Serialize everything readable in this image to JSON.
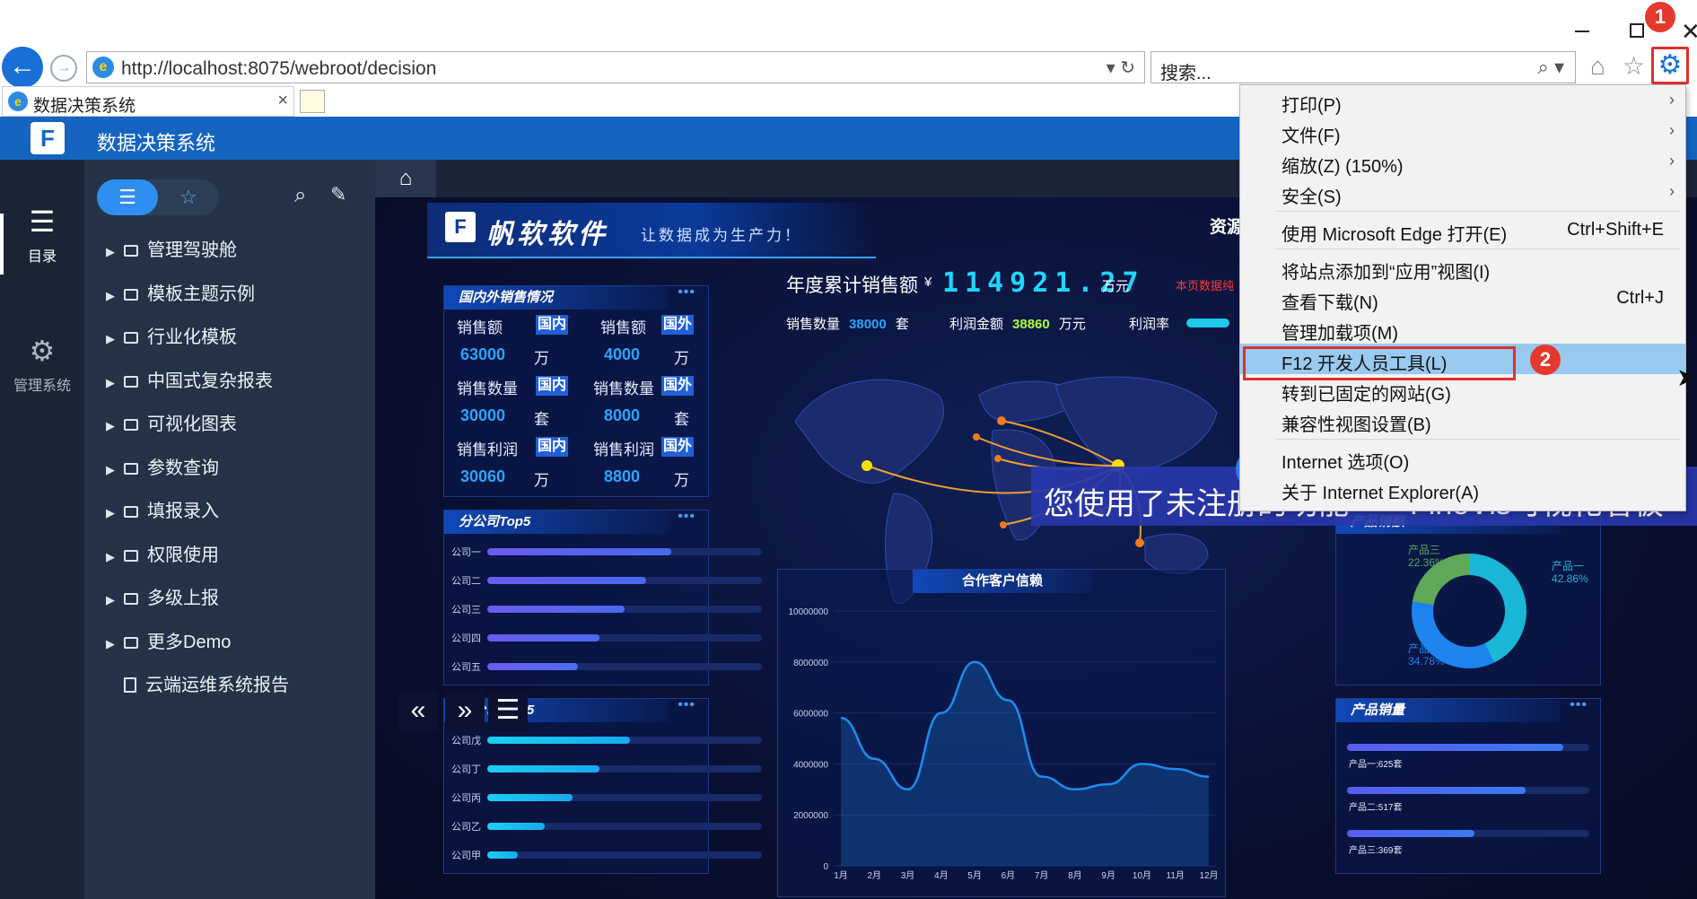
{
  "browser": {
    "address_url": "http://localhost:8075/webroot/decision",
    "search_placeholder": "搜索...",
    "tab_title": "数据决策系统",
    "markers": [
      "1",
      "2"
    ],
    "icons": [
      "back-icon",
      "forward-icon",
      "refresh-icon",
      "search-icon",
      "home-icon",
      "favorites-star-icon",
      "gear-icon"
    ]
  },
  "app": {
    "title": "数据决策系统",
    "rail": [
      {
        "label": "目录",
        "icon": "list-icon"
      },
      {
        "label": "管理系统",
        "icon": "gear-icon"
      }
    ],
    "directory": [
      {
        "label": "管理驾驶舱",
        "type": "folder"
      },
      {
        "label": "模板主题示例",
        "type": "folder"
      },
      {
        "label": "行业化模板",
        "type": "folder"
      },
      {
        "label": "中国式复杂报表",
        "type": "folder"
      },
      {
        "label": "可视化图表",
        "type": "folder"
      },
      {
        "label": "参数查询",
        "type": "folder"
      },
      {
        "label": "填报录入",
        "type": "folder"
      },
      {
        "label": "权限使用",
        "type": "folder"
      },
      {
        "label": "多级上报",
        "type": "folder"
      },
      {
        "label": "更多Demo",
        "type": "folder"
      },
      {
        "label": "云端运维系统报告",
        "type": "report"
      }
    ]
  },
  "dashboard": {
    "brand": "帆软软件",
    "slogan": "让数据成为生产力！",
    "resource_text": "资源",
    "sales_title": "国内外销售情况",
    "sales_rows": [
      {
        "label": "销售额",
        "dom_value": "63000",
        "int_value": "4000",
        "unit": "万"
      },
      {
        "label": "销售数量",
        "dom_value": "30000",
        "int_value": "8000",
        "unit": "套"
      },
      {
        "label": "销售利润",
        "dom_value": "30060",
        "int_value": "8800",
        "unit": "万"
      }
    ],
    "tag_domestic": "国内",
    "tag_foreign": "国外",
    "top5_title": "分公司Top5",
    "top5": [
      {
        "name": "公司一",
        "value": 0.67
      },
      {
        "name": "公司二",
        "value": 0.58
      },
      {
        "name": "公司三",
        "value": 0.5
      },
      {
        "name": "公司四",
        "value": 0.41
      },
      {
        "name": "公司五",
        "value": 0.33
      }
    ],
    "last5_title": "分公司Last5",
    "last5": [
      {
        "name": "公司戊",
        "value": 0.52
      },
      {
        "name": "公司丁",
        "value": 0.41
      },
      {
        "name": "公司丙",
        "value": 0.31
      },
      {
        "name": "公司乙",
        "value": 0.21
      },
      {
        "name": "公司甲",
        "value": 0.11
      }
    ],
    "kpi": {
      "title": "年度累计销售额",
      "currency": "¥",
      "value": "114921.27",
      "unit": "万元",
      "note": "本页数据纯",
      "qty_label": "销售数量",
      "qty_value": "38000",
      "qty_unit": "套",
      "profit_label": "利润金额",
      "profit_value": "38860",
      "profit_unit": "万元",
      "rate_label": "利润率"
    },
    "product_sales_title": "产品销额",
    "product_volume_title": "产品销量",
    "customer_title": "合作客户信赖",
    "popup_text": "您使用了未注册的功能——FineVis可视化看板"
  },
  "chart_data": [
    {
      "type": "pie",
      "title": "产品销额",
      "categories": [
        "产品一",
        "产品二",
        "产品三"
      ],
      "values": [
        42.86,
        34.78,
        22.36
      ],
      "labels": [
        "产品一\n42.86%",
        "产品二\n34.78%",
        "产品三\n22.36%"
      ],
      "colors": [
        "#19b6d8",
        "#1d84f0",
        "#5fa85a"
      ]
    },
    {
      "type": "bar",
      "title": "产品销量",
      "categories": [
        "产品一",
        "产品二",
        "产品三"
      ],
      "values": [
        625,
        517,
        369
      ],
      "labels": [
        "产品一:625套",
        "产品二:517套",
        "产品三:369套"
      ]
    },
    {
      "type": "area",
      "title": "合作客户信赖",
      "x": [
        "1月",
        "2月",
        "3月",
        "4月",
        "5月",
        "6月",
        "7月",
        "8月",
        "9月",
        "10月",
        "11月",
        "12月"
      ],
      "values": [
        5800000,
        4200000,
        3000000,
        6000000,
        8000000,
        6500000,
        3500000,
        3000000,
        3200000,
        4000000,
        3800000,
        3500000
      ],
      "y_ticks": [
        "0",
        "2000000",
        "4000000",
        "6000000",
        "8000000",
        "10000000"
      ],
      "ylim": [
        0,
        10000000
      ]
    }
  ],
  "menu": {
    "items": [
      {
        "label": "打印(P)",
        "shortcut": "",
        "submenu": true
      },
      {
        "label": "文件(F)",
        "shortcut": "",
        "submenu": true
      },
      {
        "label": "缩放(Z) (150%)",
        "shortcut": "",
        "submenu": true
      },
      {
        "label": "安全(S)",
        "shortcut": "",
        "submenu": true
      },
      {
        "label": "使用 Microsoft Edge 打开(E)",
        "shortcut": "Ctrl+Shift+E",
        "submenu": false
      },
      {
        "label": "将站点添加到“应用”视图(I)",
        "shortcut": "",
        "submenu": false
      },
      {
        "label": "查看下载(N)",
        "shortcut": "Ctrl+J",
        "submenu": false
      },
      {
        "label": "管理加载项(M)",
        "shortcut": "",
        "submenu": false
      },
      {
        "label": "F12 开发人员工具(L)",
        "shortcut": "",
        "submenu": false,
        "highlighted": true
      },
      {
        "label": "转到已固定的网站(G)",
        "shortcut": "",
        "submenu": false
      },
      {
        "label": "兼容性视图设置(B)",
        "shortcut": "",
        "submenu": false
      },
      {
        "label": "Internet 选项(O)",
        "shortcut": "",
        "submenu": false
      },
      {
        "label": "关于 Internet Explorer(A)",
        "shortcut": "",
        "submenu": false
      }
    ]
  }
}
